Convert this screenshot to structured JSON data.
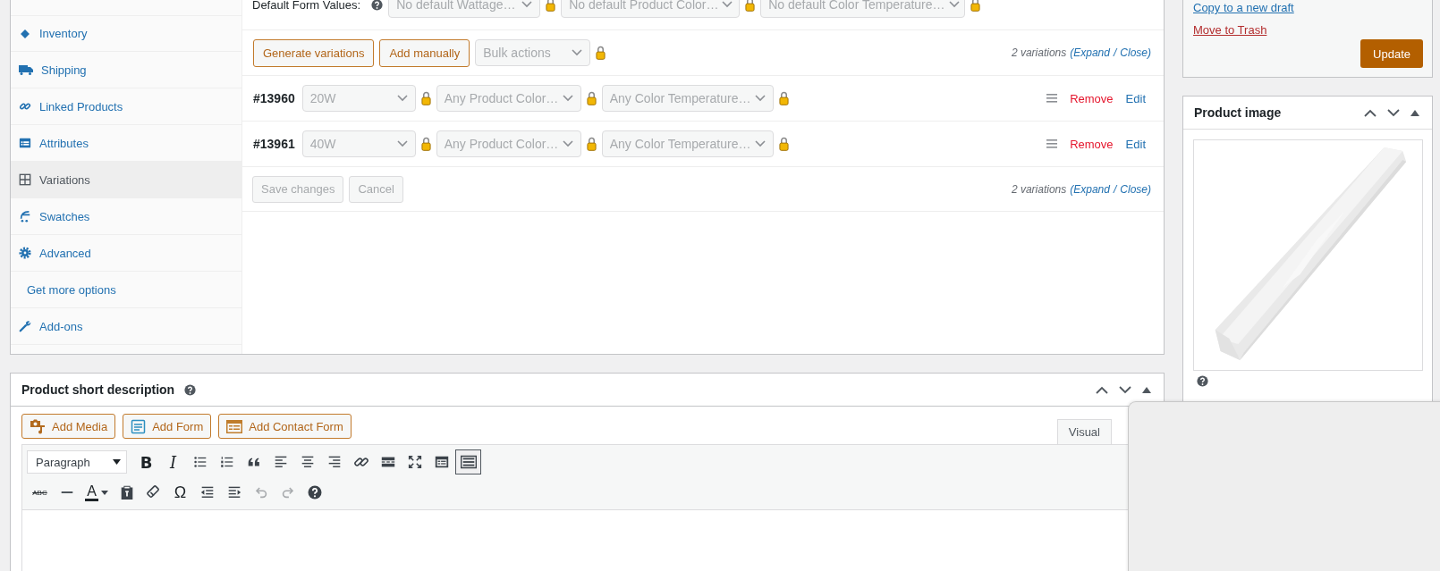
{
  "product_data": {
    "tabs": [
      {
        "label": "Inventory",
        "kind": "tag",
        "selected": false
      },
      {
        "label": "Shipping",
        "kind": "truck",
        "selected": false
      },
      {
        "label": "Linked Products",
        "kind": "link",
        "selected": false
      },
      {
        "label": "Attributes",
        "kind": "list",
        "selected": false
      },
      {
        "label": "Variations",
        "kind": "grid",
        "selected": true
      },
      {
        "label": "Swatches",
        "kind": "swatch",
        "selected": false
      },
      {
        "label": "Advanced",
        "kind": "gear",
        "selected": false
      },
      {
        "label": "Get more options",
        "kind": "none",
        "selected": false
      },
      {
        "label": "Add-ons",
        "kind": "wrench",
        "selected": false
      }
    ],
    "default_values": {
      "label": "Default Form Values:",
      "selects": [
        {
          "value": "No default Wattage…"
        },
        {
          "value": "No default Product Color…"
        },
        {
          "value": "No default Color Temperature…"
        }
      ]
    },
    "actions": {
      "buttons": [
        {
          "label": "Generate variations"
        },
        {
          "label": "Add manually"
        }
      ],
      "bulk_select": {
        "value": "Bulk actions"
      }
    },
    "summary_top": [
      {
        "kind": "count",
        "text": "2 variations"
      },
      {
        "kind": "link",
        "text": "(Expand"
      },
      {
        "kind": "sep",
        "text": "/"
      },
      {
        "kind": "link",
        "text": "Close)"
      }
    ],
    "variations": [
      {
        "id": "#13960",
        "selects": [
          {
            "value": "20W"
          },
          {
            "value": "Any Product Color…"
          },
          {
            "value": "Any Color Temperature…"
          }
        ],
        "remove": "Remove",
        "edit": "Edit"
      },
      {
        "id": "#13961",
        "selects": [
          {
            "value": "40W"
          },
          {
            "value": "Any Product Color…"
          },
          {
            "value": "Any Color Temperature…"
          }
        ],
        "remove": "Remove",
        "edit": "Edit"
      }
    ],
    "save_buttons": [
      {
        "label": "Save changes",
        "disabled": true
      },
      {
        "label": "Cancel",
        "disabled": true
      }
    ],
    "summary_bottom": [
      {
        "kind": "count",
        "text": "2 variations"
      },
      {
        "kind": "link",
        "text": "(Expand"
      },
      {
        "kind": "sep",
        "text": "/"
      },
      {
        "kind": "link",
        "text": "Close)"
      }
    ]
  },
  "short_description": {
    "title": "Product short description",
    "media_buttons": [
      {
        "label": "Add Media",
        "kind": "media"
      },
      {
        "label": "Add Form",
        "kind": "form"
      },
      {
        "label": "Add Contact Form",
        "kind": "contact"
      }
    ],
    "editor_tabs": [
      {
        "label": "Visual",
        "selected": true
      }
    ],
    "format_select": {
      "value": "Paragraph"
    },
    "toolbar_rows": [
      [
        {
          "kind": "bold",
          "label": "B",
          "pressed": false
        },
        {
          "kind": "italic",
          "label": "I",
          "pressed": false
        },
        {
          "kind": "bullets",
          "pressed": false
        },
        {
          "kind": "numbers",
          "pressed": false
        },
        {
          "kind": "quote",
          "pressed": false
        },
        {
          "kind": "alignleft",
          "pressed": false
        },
        {
          "kind": "aligncenter",
          "pressed": false
        },
        {
          "kind": "alignright",
          "pressed": false
        },
        {
          "kind": "link",
          "pressed": false
        },
        {
          "kind": "more",
          "pressed": false
        },
        {
          "kind": "fullscreen",
          "pressed": false
        },
        {
          "kind": "form",
          "pressed": false
        },
        {
          "kind": "toggle",
          "pressed": true
        }
      ],
      [
        {
          "kind": "strike",
          "label": "ABC",
          "disabled": false
        },
        {
          "kind": "hr",
          "disabled": false
        },
        {
          "kind": "color",
          "label": "A",
          "disabled": false
        },
        {
          "kind": "paste",
          "disabled": false
        },
        {
          "kind": "eraser",
          "disabled": false
        },
        {
          "kind": "omega",
          "label": "Ω",
          "disabled": false
        },
        {
          "kind": "outdent",
          "disabled": false
        },
        {
          "kind": "indent",
          "disabled": false
        },
        {
          "kind": "undo",
          "disabled": true
        },
        {
          "kind": "redo",
          "disabled": true
        },
        {
          "kind": "help",
          "disabled": false
        }
      ]
    ]
  },
  "publish": {
    "links": [
      {
        "label": "Copy to a new draft",
        "kind": "copy"
      },
      {
        "label": "Move to Trash",
        "kind": "trash"
      }
    ],
    "update_button": "Update"
  },
  "product_image": {
    "title": "Product image"
  }
}
